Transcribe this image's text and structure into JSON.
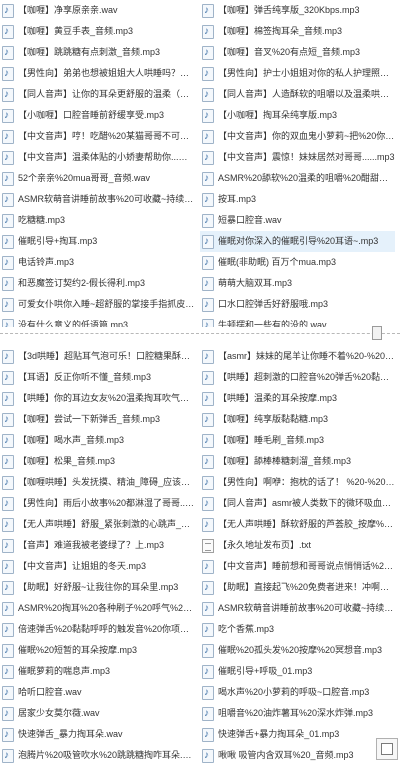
{
  "top_panel": {
    "left": [
      "【咖喱】净享原亲亲.wav",
      "【咖喱】黄豆手表_音频.mp3",
      "【咖喱】跳跳糖有点刺激_音频.mp3",
      "【男性向】弟弟也想被姐姐大人哄睡吗？%20...",
      "【同人音声】让你的耳朵更舒服的温柔（男性向...",
      "【小咖喱】口腔音睡前舒缓享受.mp3",
      "【中文音声】哼！吃醋%20某猫哥哥不可以喜...",
      "【中文音声】温柔体贴的小娇妻帮助你...安慰...",
      "52个亲亲%20mua哥哥_音频.wav",
      "ASMR软萌音讲睡前故事%20可收藏~持续更...",
      "吃糖糖.mp3",
      "催眠引导+掏耳.mp3",
      "电话铃声.mp3",
      "和恶魔签订契约2-假长得利.mp3",
      "可爱女仆哄你入睡~超舒服的掌接手指抓皮声...",
      "没有什么意义的低语篇.mp3"
    ],
    "right": [
      "【咖喱】弹舌纯享版_320Kbps.mp3",
      "【咖喱】棉签掏耳朵_音频.mp3",
      "【咖喱】音叉%20有点短_音频.mp3",
      "【男性向】护士小姐姐对你的私人护理照顾%...",
      "【同人音声】人造酥软的咀嚼以及温柔哄睡（...",
      "【小咖喱】掏耳朵纯享版.mp3",
      "【中文音声】你的双血鬼小萝莉~把%20你的...",
      "【中文音声】震惊！妹妹居然对哥哥......mp3",
      "ASMR%20舔软%20温柔的咀嚼%20酣甜的你...",
      "按耳.mp3",
      "短暴口腔音.wav",
      "催眠对你深入的催眠引导%20耳语~.mp3",
      "催眠(非助眠)  百万个mua.mp3",
      "萌萌大脑双耳.mp3",
      "口水口腔弹舌好舒服哦.mp3",
      "牛顿摆和一些有的没的.wav"
    ]
  },
  "bottom_panel": {
    "left": [
      "【3d哄睡】超贴耳气泡可乐！口腔糖果酥软升...",
      "【耳语】反正你听不懂_音频.mp3",
      "【哄睡】你的耳边女友%20温柔掏耳吹气晚安...",
      "【咖喱】尝试一下新弹舌_音频.mp3",
      "【咖喱】喝水声_音频.mp3",
      "【咖喱】松果_音频.mp3",
      "【咖喱哄睡】头发抚摸、精油_障碍_应该是这...",
      "【男性向】雨后小故事%20都淋湿了哥哥...不...",
      "【无人声哄睡】舒服_紧张刺激的心跳声_咚~...",
      "【音声】难道我被老婆绿了？上.mp3",
      "【中文音声】让姐姐的冬天.mp3",
      "【助眠】好舒服~让我往你的耳朵里.mp3",
      "ASMR%20掏耳%20各种刷子%20呼气%20晚...",
      "倍速弹舌%20黏黏呼呼的触发音%20你项的住...",
      "催眠%20短暂的耳朵按摩.mp3",
      "催眠萝莉的喘息声.mp3",
      "哈听口腔音.wav",
      "居家少女莫尔薇.wav",
      "快速弹舌_暴力掏耳朵.wav",
      "泡腾片%20吸管吹水%20跳跳糖掏咋耳朵.mp3"
    ],
    "right": [
      "【asmr】妹妹的尾羊让你睡不着%20-%201...",
      "【哄睡】超刺激的口腔音%20弹舌%20黏黏糖...",
      "【哄睡】温柔的耳朵按摩.mp3",
      "【咖喱】纯享版黏黏糖.mp3",
      "【咖喱】睡毛刷_音频.mp3",
      "【咖喱】舔棒棒糖刺溜_音频.mp3",
      "【男性向】啊咿：抱枕的话了！ %20-%201...",
      "【同人音声】asmr被人类数下的微环吸血鬼%...",
      "【无人声哄睡】酥软舒服的芦荟胶_按摩%20-...",
      "【永久地址发布页】.txt",
      "【中文音声】睡前想和哥哥说点悄悄话%20-...",
      "【助眠】直接起飞%20免费者进来！冲啊！...",
      "ASMR软萌音讲睡前故事%20可收藏~持续更...",
      "吃个香蕉.mp3",
      "催眠%20孤头发%20按摩%20冥想音.mp3",
      "催眠引导+呼吸_01.mp3",
      "喝水声%20小萝莉的呼吸~口腔音.mp3",
      "咀嚼音%20油炸薯耳%20深水炸弹.mp3",
      "快速弹舌+暴力掏耳朵_01.mp3",
      "啾啾  吸管内含双耳%20_音频.mp3"
    ]
  },
  "icons": {
    "audio": "audio-file-icon",
    "text": "text-file-icon"
  },
  "colors": {
    "selection": "#e5f1fb",
    "text": "#333333",
    "icon_accent": "#3a6ea5"
  },
  "selected": {
    "panel": "top_panel",
    "column": "right",
    "index": 11
  }
}
